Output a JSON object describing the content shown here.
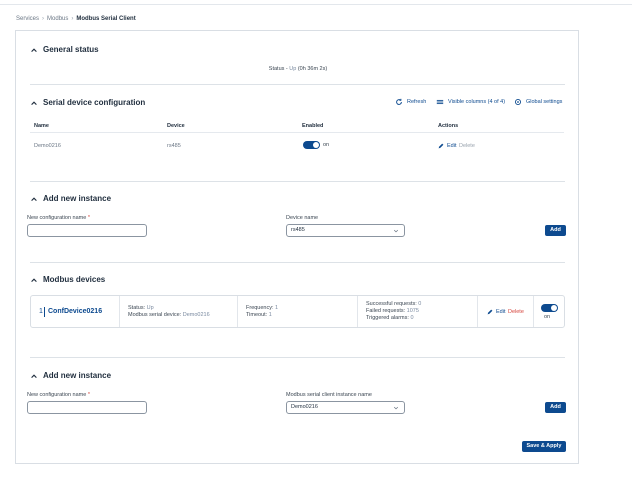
{
  "breadcrumb": {
    "items": [
      "Services",
      "Modbus",
      "Modbus Serial Client"
    ]
  },
  "general_status": {
    "title": "General status",
    "status_label": "Status",
    "status_sep": "-",
    "status_value": "Up",
    "status_uptime": "(0h 36m 2s)"
  },
  "serial_config": {
    "title": "Serial device configuration",
    "refresh_label": "Refresh",
    "visible_columns_label": "Visible columns (4 of 4)",
    "global_settings_label": "Global settings",
    "columns": {
      "name": "Name",
      "device": "Device",
      "enabled": "Enabled",
      "actions": "Actions"
    },
    "rows": [
      {
        "name": "Demo0216",
        "device": "rs485",
        "enabled_label": "on",
        "edit_label": "Edit",
        "delete_label": "Delete"
      }
    ]
  },
  "add_instance_1": {
    "title": "Add new instance",
    "name_label": "New configuration name",
    "required_mark": "*",
    "name_value": "",
    "device_label": "Device name",
    "device_value": "rs485",
    "add_label": "Add"
  },
  "modbus_devices": {
    "title": "Modbus devices",
    "devices": [
      {
        "index": "1",
        "name": "ConfDevice0216",
        "status_label": "Status:",
        "status_value": "Up",
        "serial_label": "Modbus serial device:",
        "serial_value": "Demo0216",
        "frequency_label": "Frequency:",
        "frequency_value": "1",
        "timeout_label": "Timeout:",
        "timeout_value": "1",
        "success_label": "Successful requests:",
        "success_value": "0",
        "failed_label": "Failed requests:",
        "failed_value": "1075",
        "alarms_label": "Triggered alarms:",
        "alarms_value": "0",
        "edit_label": "Edit",
        "delete_label": "Delete",
        "toggle_label": "on"
      }
    ]
  },
  "add_instance_2": {
    "title": "Add new instance",
    "name_label": "New configuration name",
    "required_mark": "*",
    "name_value": "",
    "instance_label": "Modbus serial client instance name",
    "instance_value": "Demo0216",
    "add_label": "Add"
  },
  "footer": {
    "save_apply_label": "Save & Apply"
  },
  "colors": {
    "primary": "#0d4a8f",
    "danger": "#d6453d",
    "muted": "#7a8aa0"
  }
}
